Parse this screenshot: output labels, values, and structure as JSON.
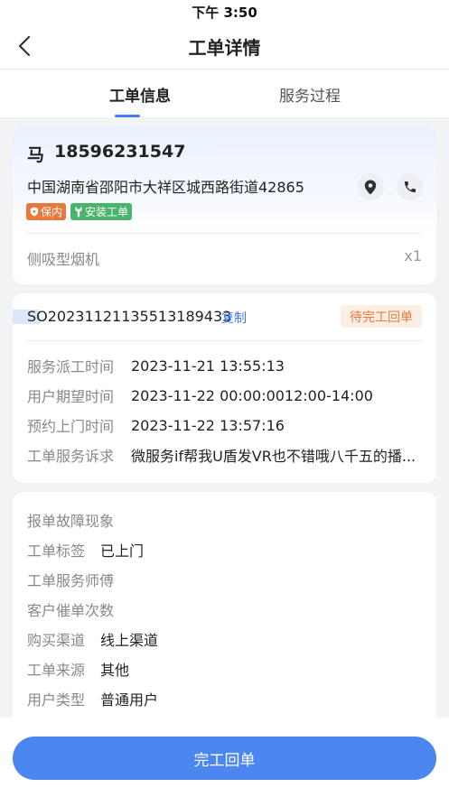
{
  "status_bar": {
    "time": "下午 3:50"
  },
  "nav": {
    "title": "工单详情"
  },
  "tabs": [
    {
      "label": "工单信息",
      "active": true
    },
    {
      "label": "服务过程",
      "active": false
    }
  ],
  "customer": {
    "name": "马",
    "phone": "18596231547",
    "address": "中国湖南省邵阳市大祥区城西路街道42865",
    "tags": [
      {
        "label": "保内",
        "color": "#e8783b",
        "icon": "shield-icon"
      },
      {
        "label": "安装工单",
        "color": "#4bb46b",
        "icon": "wrench-icon"
      }
    ]
  },
  "product": {
    "name": "侧吸型烟机",
    "quantity": "x1"
  },
  "order": {
    "number": "SO20231121135513189433",
    "copy_label": "复制",
    "status": "待完工回单",
    "rows": [
      {
        "label": "服务派工时间",
        "value": "2023-11-21 13:55:13"
      },
      {
        "label": "用户期望时间",
        "value": "2023-11-22 00:00:0012:00-14:00"
      },
      {
        "label": "预约上门时间",
        "value": "2023-11-22 13:57:16"
      },
      {
        "label": "工单服务诉求",
        "value": "微服务if帮我U盾发VR也不错哦八千五的播..."
      }
    ]
  },
  "details": {
    "rows": [
      {
        "label": "报单故障现象",
        "value": ""
      },
      {
        "label": "工单标签",
        "value": "已上门"
      },
      {
        "label": "工单服务师傅",
        "value": ""
      },
      {
        "label": "客户催单次数",
        "value": ""
      },
      {
        "label": "购买渠道",
        "value": "线上渠道"
      },
      {
        "label": "工单来源",
        "value": "其他"
      },
      {
        "label": "用户类型",
        "value": "普通用户"
      }
    ]
  },
  "footer": {
    "button_label": "完工回单"
  },
  "colors": {
    "accent": "#3f7cf6",
    "button": "#4c86f1",
    "status_orange": "#e8783b",
    "tag_green": "#4bb46b"
  }
}
